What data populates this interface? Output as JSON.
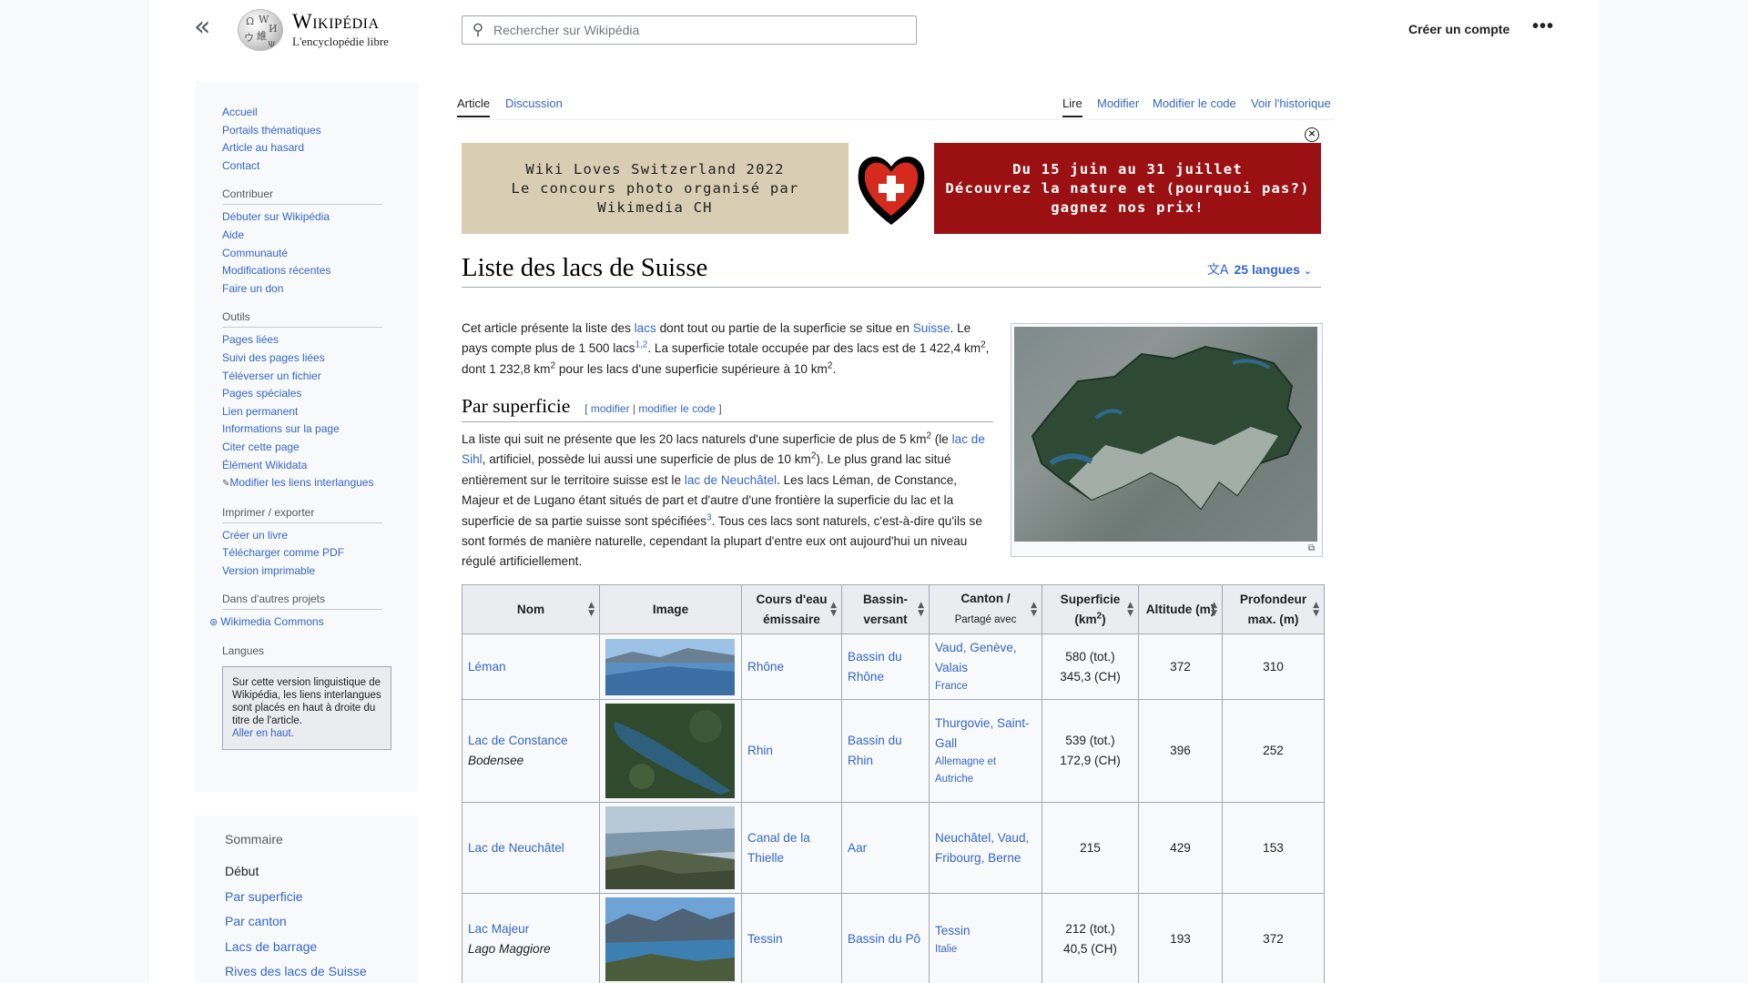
{
  "header": {
    "logo_title": "Wikipédia",
    "logo_subtitle": "L'encyclopédie libre",
    "search_placeholder": "Rechercher sur Wikipédia",
    "create_account": "Créer un compte"
  },
  "sidebar": {
    "main": [
      "Accueil",
      "Portails thématiques",
      "Article au hasard",
      "Contact"
    ],
    "contribute_head": "Contribuer",
    "contribute": [
      "Débuter sur Wikipédia",
      "Aide",
      "Communauté",
      "Modifications récentes",
      "Faire un don"
    ],
    "tools_head": "Outils",
    "tools": [
      "Pages liées",
      "Suivi des pages liées",
      "Téléverser un fichier",
      "Pages spéciales",
      "Lien permanent",
      "Informations sur la page",
      "Citer cette page",
      "Élément Wikidata",
      "Modifier les liens interlangues"
    ],
    "print_head": "Imprimer / exporter",
    "print": [
      "Créer un livre",
      "Télécharger comme PDF",
      "Version imprimable"
    ],
    "projects_head": "Dans d'autres projets",
    "projects": [
      "Wikimedia Commons"
    ],
    "langs_head": "Langues",
    "langs_note": "Sur cette version linguistique de Wikipédia, les liens interlangues sont placés en haut à droite du titre de l'article.",
    "langs_note_link": "Aller en haut."
  },
  "toc": {
    "title": "Sommaire",
    "items": [
      "Début",
      "Par superficie",
      "Par canton",
      "Lacs de barrage",
      "Rives des lacs de Suisse"
    ]
  },
  "tabs": {
    "article": "Article",
    "discussion": "Discussion",
    "read": "Lire",
    "edit": "Modifier",
    "edit_code": "Modifier le code",
    "history": "Voir l'historique"
  },
  "banner": {
    "left": [
      "Wiki Loves Switzerland 2022",
      "Le concours photo organisé par",
      "Wikimedia CH"
    ],
    "right": [
      "Du 15 juin au 31 juillet",
      "Découvrez la nature et (pourquoi pas?)",
      "gagnez nos prix!"
    ]
  },
  "article": {
    "title": "Liste des lacs de Suisse",
    "languages": "25 langues",
    "section_title": "Par superficie",
    "edit_link": "modifier",
    "edit_code_link": "modifier le code"
  },
  "table": {
    "headers": {
      "nom": "Nom",
      "image": "Image",
      "cours": "Cours d'eau émissaire",
      "bassin": "Bassin-versant",
      "canton": "Canton /",
      "canton_sub": "Partagé avec",
      "superficie": "Superficie (km",
      "altitude": "Altitude (m)",
      "profondeur": "Profondeur max. (m)"
    },
    "rows": [
      {
        "nom": "Léman",
        "alt": "",
        "cours": "Rhône",
        "bassin": "Bassin du Rhône",
        "canton": "Vaud, Genève, Valais",
        "partage": "France",
        "sup1": "580  (tot.)",
        "sup2": "345,3 (CH)",
        "altitude": "372",
        "prof": "310"
      },
      {
        "nom": "Lac de Constance",
        "alt": "Bodensee",
        "cours": "Rhin",
        "bassin": "Bassin du Rhin",
        "canton": "Thurgovie, Saint-Gall",
        "partage": "Allemagne et Autriche",
        "sup1": "539  (tot.)",
        "sup2": "172,9 (CH)",
        "altitude": "396",
        "prof": "252"
      },
      {
        "nom": "Lac de Neuchâtel",
        "alt": "",
        "cours": "Canal de la Thielle",
        "bassin": "Aar",
        "canton": "Neuchâtel, Vaud, Fribourg, Berne",
        "partage": "",
        "sup1": "215",
        "sup2": "",
        "altitude": "429",
        "prof": "153"
      },
      {
        "nom": "Lac Majeur",
        "alt": "Lago Maggiore",
        "cours": "Tessin",
        "bassin": "Bassin du Pô",
        "canton": "Tessin",
        "partage": "Italie",
        "sup1": "212  (tot.)",
        "sup2": "40,5 (CH)",
        "altitude": "193",
        "prof": "372"
      }
    ]
  }
}
